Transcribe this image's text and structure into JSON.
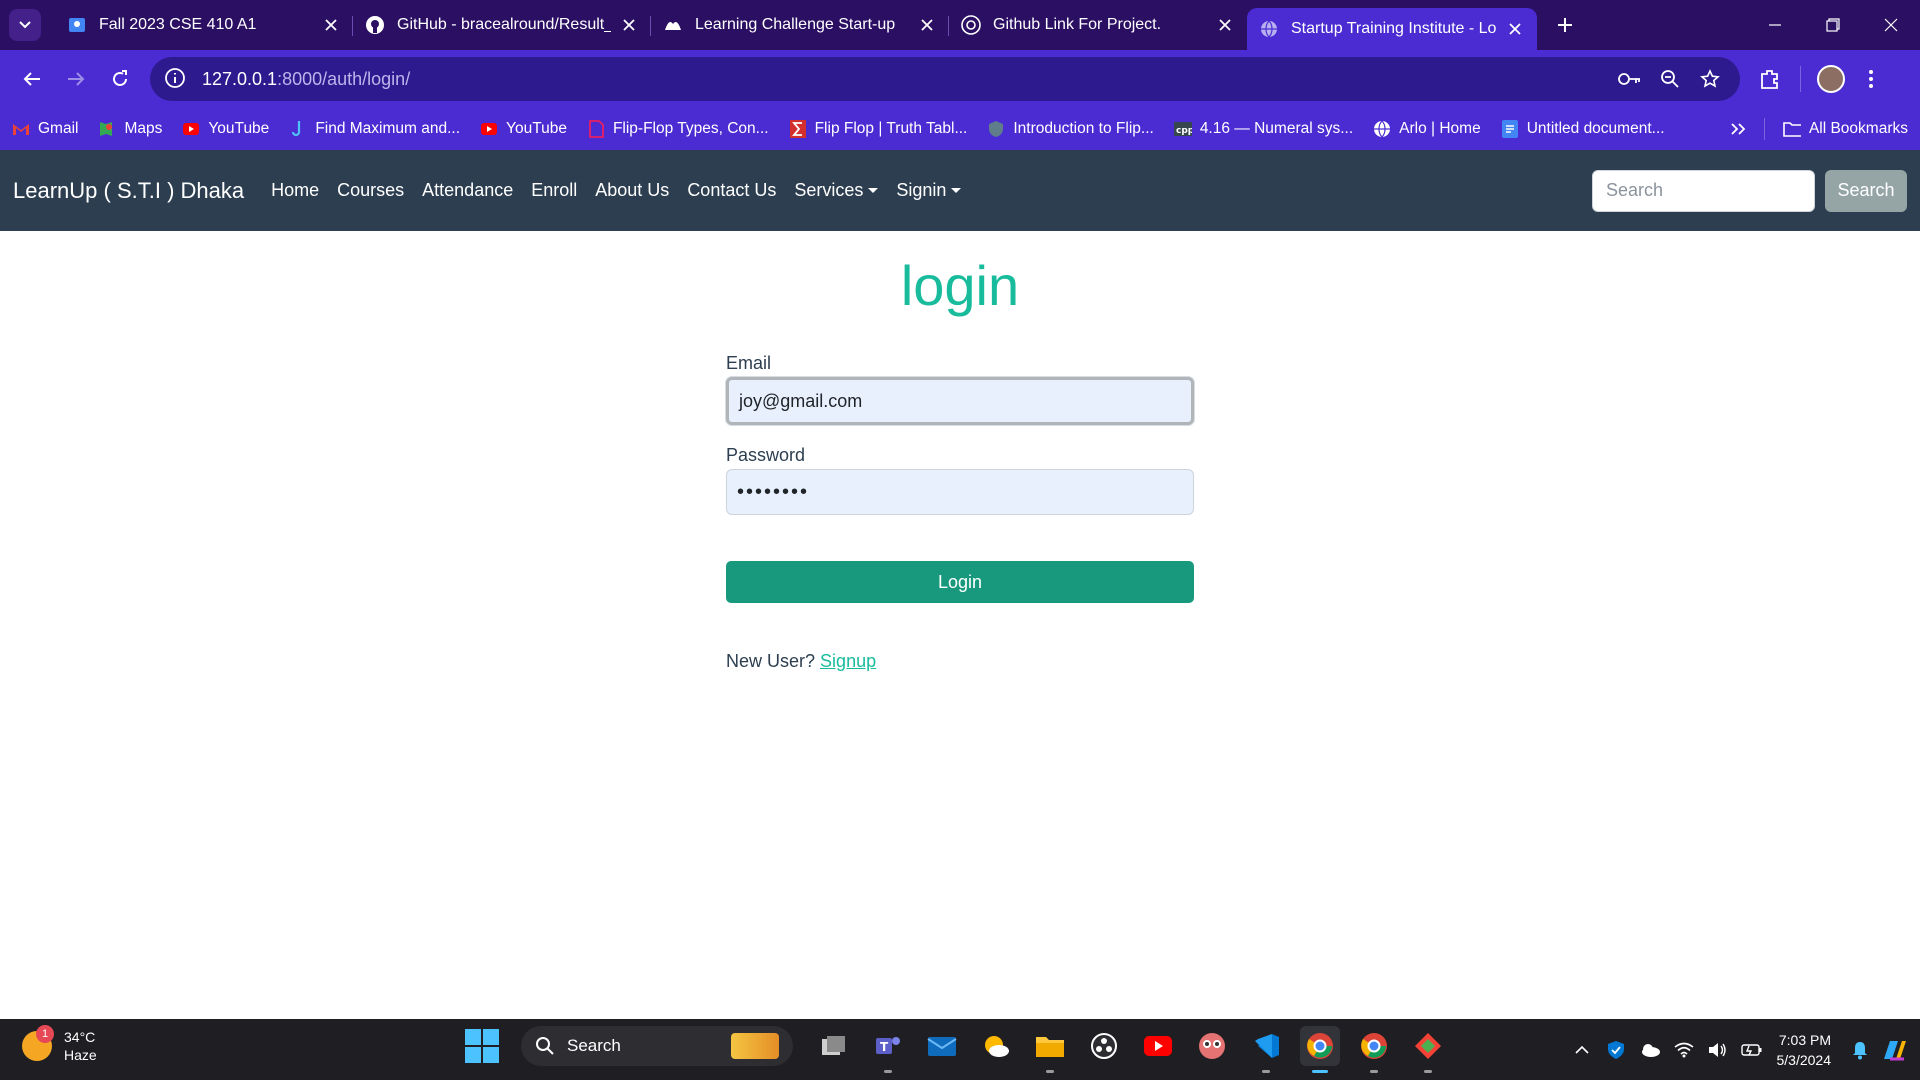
{
  "browser": {
    "tabs": [
      {
        "title": "Fall 2023 CSE 410 A1",
        "icon": "classroom-icon",
        "color": "#4285f4"
      },
      {
        "title": "GitHub - bracealround/Result_P",
        "icon": "github-icon",
        "color": "#ffffff"
      },
      {
        "title": "Learning Challenge Start-up",
        "icon": "learning-icon",
        "color": "#ffffff"
      },
      {
        "title": "Github Link For Project.",
        "icon": "chatgpt-icon",
        "color": "#ffffff"
      },
      {
        "title": "Startup Training Institute - Login",
        "icon": "globe-icon",
        "color": "#ffffff",
        "active": true
      }
    ],
    "url_host": "127.0.0.1",
    "url_path": ":8000/auth/login/",
    "bookmarks": [
      {
        "label": "Gmail",
        "icon": "gmail-icon",
        "color": "#ea4335"
      },
      {
        "label": "Maps",
        "icon": "maps-icon",
        "color": "#34a853"
      },
      {
        "label": "YouTube",
        "icon": "youtube-icon",
        "color": "#ff0000"
      },
      {
        "label": "Find Maximum and...",
        "icon": "hook-icon",
        "color": "#4fc3f7"
      },
      {
        "label": "YouTube",
        "icon": "youtube-icon",
        "color": "#ff0000"
      },
      {
        "label": "Flip-Flop Types, Con...",
        "icon": "bookmark-doc-icon",
        "color": "#e91e63"
      },
      {
        "label": "Flip Flop | Truth Tabl...",
        "icon": "sigma-icon",
        "color": "#d32f2f"
      },
      {
        "label": "Introduction to Flip...",
        "icon": "shield-icon",
        "color": "#607d8b"
      },
      {
        "label": "4.16 — Numeral sys...",
        "icon": "cpp-icon",
        "color": "#37474f"
      },
      {
        "label": "Arlo | Home",
        "icon": "globe-icon",
        "color": "#ffffff"
      },
      {
        "label": "Untitled document...",
        "icon": "docs-icon",
        "color": "#4285f4"
      }
    ],
    "all_bookmarks": "All Bookmarks"
  },
  "site": {
    "brand": "LearnUp ( S.T.I ) Dhaka",
    "nav": [
      "Home",
      "Courses",
      "Attendance",
      "Enroll",
      "About Us",
      "Contact Us"
    ],
    "dropdowns": [
      "Services",
      "Signin"
    ],
    "search_placeholder": "Search",
    "search_button": "Search"
  },
  "login": {
    "heading": "login",
    "email_label": "Email",
    "email_value": "joy@gmail.com",
    "password_label": "Password",
    "password_value": "••••••••",
    "button": "Login",
    "new_user": "New User?",
    "signup": "Signup"
  },
  "taskbar": {
    "temp": "34°C",
    "weather": "Haze",
    "weather_badge": "1",
    "search": "Search",
    "time": "7:03 PM",
    "date": "5/3/2024"
  },
  "colors": {
    "tabstrip": "#2b0f63",
    "toolbar": "#4a2cd2",
    "navbar": "#2c3e50",
    "accent": "#18bc9c",
    "button": "#18997d"
  }
}
